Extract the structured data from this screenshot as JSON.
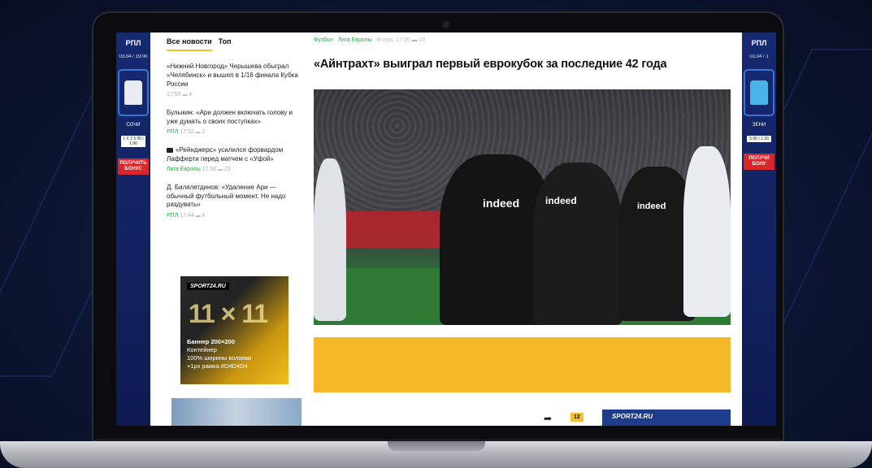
{
  "rails": {
    "left": {
      "logo": "РПЛ",
      "date": "03.04 / 19:00",
      "team": "СОЧИ",
      "odds": "1  X  2  5.90 | 1.90",
      "bonus": "ПОЛУЧИТЬ БОНУС"
    },
    "right": {
      "logo": "РПЛ",
      "date": "03.04 / 1",
      "team": "ЗЕНИ",
      "odds": "5.90 | 1.90",
      "bonus": "ПОЛУЧИ БОНУ"
    }
  },
  "news": {
    "tabs": [
      "Все новости",
      "Топ"
    ],
    "items": [
      {
        "text": "«Нижний Новгород» Черышева обыграл «Челябинск» и вышел в 1/16 финала Кубка России",
        "source": "",
        "time": "17:55",
        "count": "4"
      },
      {
        "text": "Булыкин: «Ари должен включать голову и уже думать о своих поступках»",
        "source": "РПЛ",
        "time": "17:52",
        "count": "2"
      },
      {
        "text": "«Рейнджерс» усилился форвардом Лафферти перед матчем с «Уфой»",
        "source": "Лига Европы",
        "time": "17:50",
        "count": "23"
      },
      {
        "text": "Д. Билялетдинов: «Удаление Ари — обычный футбольный момент. Не надо раздувать»",
        "source": "РПЛ",
        "time": "17:44",
        "count": "4"
      }
    ],
    "ad": {
      "brand": "SPORT24.RU",
      "big": "11 × 11",
      "line1": "Баннер 200×200",
      "line2": "Контейнер",
      "line3": "100% ширины колонки",
      "line4": "+1px рамка #D4D4D4"
    }
  },
  "article": {
    "crumbs": {
      "cat1": "Футбол",
      "cat2": "Лига Европы",
      "date": "Вчера, 17:00",
      "count": "23"
    },
    "headline": "«Айнтрахт» выиграл первый еврокубок за последние 42 года",
    "sponsor_text": "indeed",
    "badge": "12",
    "bottom_ad": "SPORT24.RU"
  },
  "colors": {
    "accent": "#f5c22d",
    "green_source": "#2aa84a",
    "rail": "#162a72",
    "yellow_ad": "#f5b829"
  }
}
